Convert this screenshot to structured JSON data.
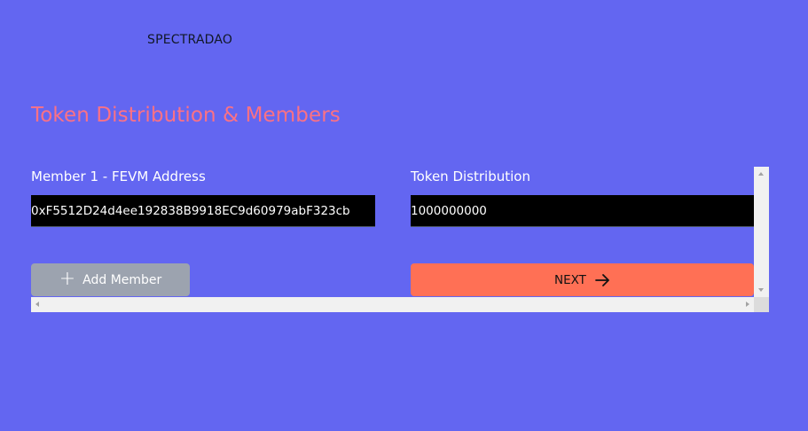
{
  "header": {
    "brand": "SPECTRADAO"
  },
  "page": {
    "title": "Token Distribution & Members"
  },
  "members": [
    {
      "address_label": "Member 1 - FEVM Address",
      "address_value": "0xF5512D24d4ee192838B9918EC9d60979abF323cb",
      "distribution_label": "Token Distribution",
      "distribution_value": "1000000000"
    }
  ],
  "actions": {
    "add_member_label": "Add Member",
    "add_member_icon": "plus-icon",
    "next_label": "NEXT",
    "next_icon": "arrow-right-icon"
  },
  "colors": {
    "background": "#6366f1",
    "title": "#fb7185",
    "next_button": "#ff7055",
    "add_button": "#9ca3af",
    "input_background": "#000000"
  }
}
